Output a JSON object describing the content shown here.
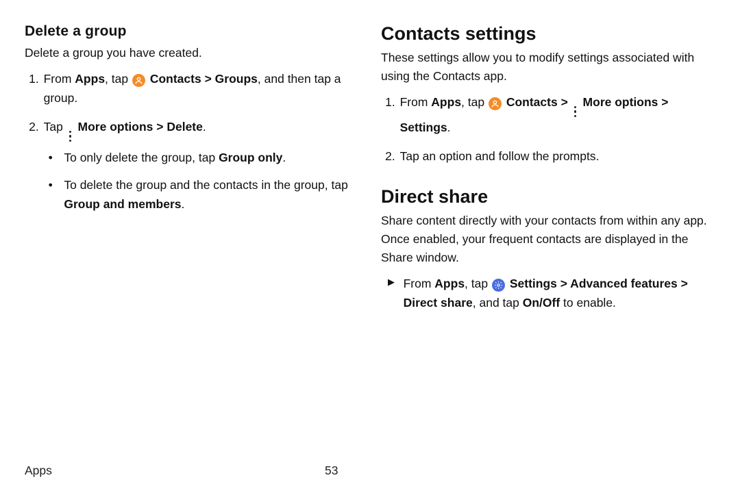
{
  "left": {
    "heading": "Delete a group",
    "intro": "Delete a group you have created.",
    "step1_a": "From ",
    "step1_b": "Apps",
    "step1_c": ", tap ",
    "step1_d": " Contacts ",
    "step1_e": " Groups",
    "step1_f": ", and then tap a group.",
    "step2_a": "Tap ",
    "step2_b": " More options ",
    "step2_c": " Delete",
    "step2_d": ".",
    "bullet1_a": "To only delete the group, tap ",
    "bullet1_b": "Group only",
    "bullet1_c": ".",
    "bullet2_a": "To delete the group and the contacts in the group, tap ",
    "bullet2_b": "Group and members",
    "bullet2_c": "."
  },
  "right": {
    "section1": {
      "heading": "Contacts settings",
      "intro": "These settings allow you to modify settings associated with using the Contacts app.",
      "step1_a": "From ",
      "step1_b": "Apps",
      "step1_c": ", tap ",
      "step1_d": " Contacts ",
      "step1_e": " More options ",
      "step1_f": "Settings",
      "step1_g": ".",
      "step2": "Tap an option and follow the prompts."
    },
    "section2": {
      "heading": "Direct share",
      "intro": "Share content directly with your contacts from within any app. Once enabled, your frequent contacts are displayed in the Share window.",
      "step1_a": "From ",
      "step1_b": "Apps",
      "step1_c": ", tap ",
      "step1_d": " Settings ",
      "step1_e": " Advanced features ",
      "step1_f": "Direct share",
      "step1_g": ", and tap ",
      "step1_h": "On/Off",
      "step1_i": " to enable."
    }
  },
  "chevron": ">",
  "footer": {
    "section": "Apps",
    "page": "53"
  }
}
